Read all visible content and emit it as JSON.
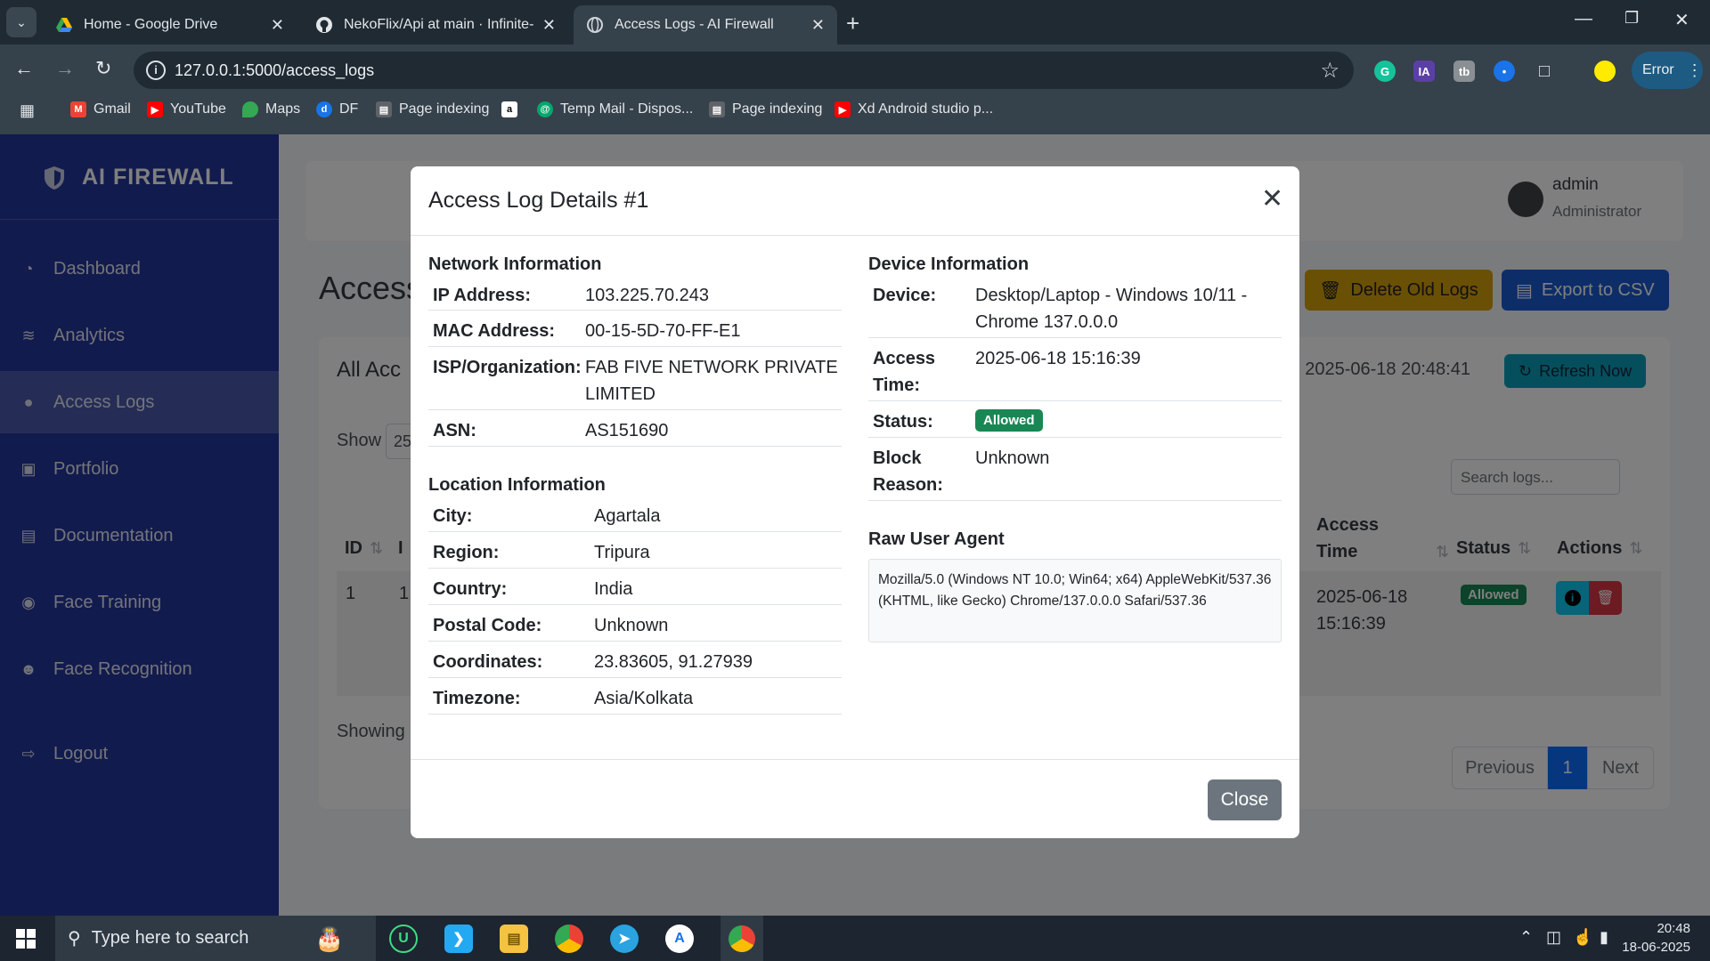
{
  "browser": {
    "tabs": [
      {
        "title": "Home - Google Drive",
        "active": false
      },
      {
        "title": "NekoFlix/Api at main · Infinite-l",
        "active": false
      },
      {
        "title": "Access Logs - AI Firewall",
        "active": true
      }
    ],
    "url": "127.0.0.1:5000/access_logs",
    "error_label": "Error",
    "extensions": [
      "grammarly-icon",
      "ia-icon",
      "tb-icon",
      "blue-ext-icon",
      "puzzle-icon",
      "profile-dot"
    ],
    "bookmarks": [
      {
        "label": "Gmail",
        "icon": "gmail-icon",
        "color": "#ea4335"
      },
      {
        "label": "YouTube",
        "icon": "youtube-icon",
        "color": "#ff0000"
      },
      {
        "label": "Maps",
        "icon": "maps-icon",
        "color": "#34a853"
      },
      {
        "label": "DF",
        "icon": "df-icon",
        "color": "#1a73e8"
      },
      {
        "label": "Page indexing",
        "icon": "search-console-icon",
        "color": "#5f6368"
      },
      {
        "label": "",
        "icon": "amazon-icon",
        "color": "#000000"
      },
      {
        "label": "Temp Mail - Dispos...",
        "icon": "tempmail-icon",
        "color": "#00a86b"
      },
      {
        "label": "Page indexing",
        "icon": "search-console-icon",
        "color": "#5f6368"
      },
      {
        "label": "Xd Android studio p...",
        "icon": "youtube-icon",
        "color": "#ff0000"
      }
    ]
  },
  "sidebar": {
    "brand": "AI FIREWALL",
    "items": [
      {
        "label": "Dashboard",
        "icon": "gauge-icon",
        "active": false
      },
      {
        "label": "Analytics",
        "icon": "chart-line-icon",
        "active": false
      },
      {
        "label": "Access Logs",
        "icon": "user-lock-icon",
        "active": true
      },
      {
        "label": "Portfolio",
        "icon": "briefcase-icon",
        "active": false
      },
      {
        "label": "Documentation",
        "icon": "file-icon",
        "active": false
      },
      {
        "label": "Face Training",
        "icon": "camera-icon",
        "active": false
      },
      {
        "label": "Face Recognition",
        "icon": "users-icon",
        "active": false
      },
      {
        "label": "Logout",
        "icon": "logout-icon",
        "active": false
      }
    ]
  },
  "user": {
    "name": "admin",
    "role": "Administrator"
  },
  "page": {
    "title": "Access",
    "delete_old_logs": "Delete Old Logs",
    "export_csv": "Export to CSV",
    "card_title": "All Acc",
    "last_updated": "d: 2025-06-18 20:48:41",
    "refresh": "Refresh Now",
    "show_label": "Show",
    "show_value": "25",
    "search_placeholder": "Search logs...",
    "showing": "Showing",
    "columns": {
      "id": "ID",
      "i": "I",
      "access_time": "Access Time",
      "status": "Status",
      "actions": "Actions"
    },
    "row": {
      "id": "1",
      "col2": "1",
      "access_time": "2025-06-18 15:16:39",
      "status": "Allowed"
    },
    "pagination": {
      "previous": "Previous",
      "current": "1",
      "next": "Next"
    }
  },
  "modal": {
    "title": "Access Log Details #1",
    "network": {
      "heading": "Network Information",
      "rows": [
        {
          "label": "IP Address:",
          "value": "103.225.70.243"
        },
        {
          "label": "MAC Address:",
          "value": "00-15-5D-70-FF-E1"
        },
        {
          "label": "ISP/Organization:",
          "value": "FAB FIVE NETWORK PRIVATE LIMITED"
        },
        {
          "label": "ASN:",
          "value": "AS151690"
        }
      ]
    },
    "location": {
      "heading": "Location Information",
      "rows": [
        {
          "label": "City:",
          "value": "Agartala"
        },
        {
          "label": "Region:",
          "value": "Tripura"
        },
        {
          "label": "Country:",
          "value": "India"
        },
        {
          "label": "Postal Code:",
          "value": "Unknown"
        },
        {
          "label": "Coordinates:",
          "value": "23.83605, 91.27939"
        },
        {
          "label": "Timezone:",
          "value": "Asia/Kolkata"
        }
      ]
    },
    "device": {
      "heading": "Device Information",
      "rows": [
        {
          "label": "Device:",
          "value": "Desktop/Laptop - Windows 10/11 - Chrome 137.0.0.0"
        },
        {
          "label": "Access Time:",
          "value": "2025-06-18 15:16:39"
        },
        {
          "label": "Status:",
          "value": "Allowed"
        },
        {
          "label": "Block Reason:",
          "value": "Unknown"
        }
      ]
    },
    "raw_ua": {
      "heading": "Raw User Agent",
      "text": "Mozilla/5.0 (Windows NT 10.0; Win64; x64) AppleWebKit/537.36 (KHTML, like Gecko) Chrome/137.0.0.0 Safari/537.36"
    },
    "close_label": "Close"
  },
  "taskbar": {
    "search_placeholder": "Type here to search",
    "time": "20:48",
    "date": "18-06-2025"
  },
  "colors": {
    "sidebar": "#24379a",
    "success": "#198754",
    "warning": "#ffc107",
    "primary": "#0d6efd",
    "info": "#0dcaf0",
    "danger": "#dc3545"
  }
}
